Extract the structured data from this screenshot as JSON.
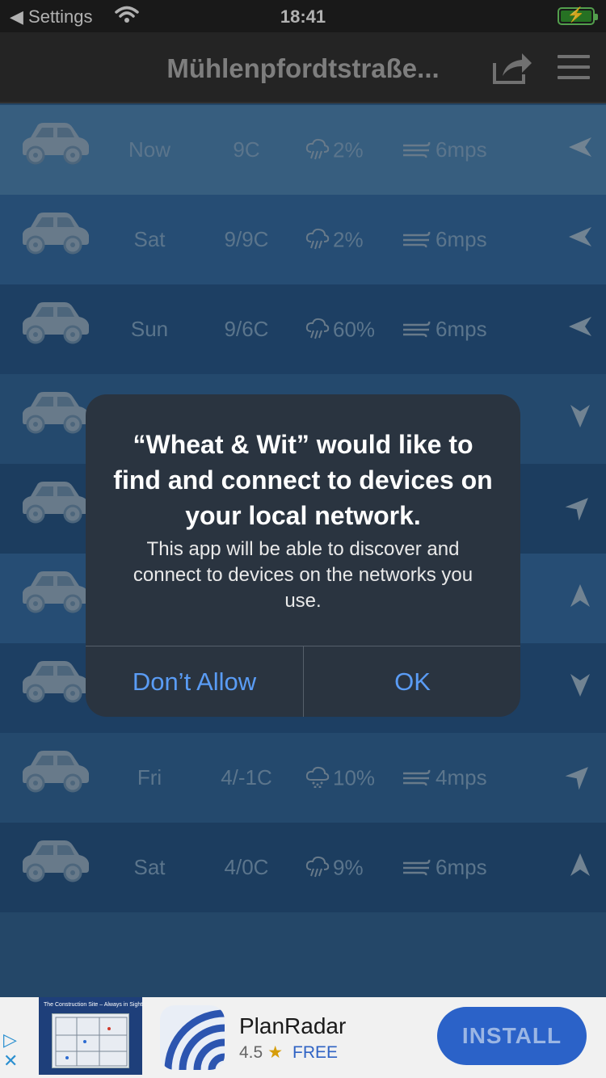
{
  "status_bar": {
    "back_label": "◀ Settings",
    "time": "18:41"
  },
  "nav": {
    "title": "Mühlenpfordtstraße..."
  },
  "rows": [
    {
      "day": "Now",
      "temp": "9C",
      "rain": "2%",
      "wind": "6mps",
      "bg": "#44739b",
      "precip_icon": "rain-cloud-icon",
      "dir_rotation_deg": 270
    },
    {
      "day": "Sat",
      "temp": "9/9C",
      "rain": "2%",
      "wind": "6mps",
      "bg": "#2f5f8e",
      "precip_icon": "rain-cloud-icon",
      "dir_rotation_deg": 270
    },
    {
      "day": "Sun",
      "temp": "9/6C",
      "rain": "60%",
      "wind": "6mps",
      "bg": "#244e79",
      "precip_icon": "rain-cloud-icon",
      "dir_rotation_deg": 270
    },
    {
      "day": "",
      "temp": "",
      "rain": "",
      "wind": "",
      "bg": "#2c5a86",
      "precip_icon": "",
      "dir_rotation_deg": 180
    },
    {
      "day": "",
      "temp": "",
      "rain": "",
      "wind": "",
      "bg": "#234b74",
      "precip_icon": "",
      "dir_rotation_deg": 45
    },
    {
      "day": "",
      "temp": "",
      "rain": "",
      "wind": "",
      "bg": "#2f5f8e",
      "precip_icon": "",
      "dir_rotation_deg": 0
    },
    {
      "day": "",
      "temp": "",
      "rain": "",
      "wind": "",
      "bg": "#244e79",
      "precip_icon": "",
      "dir_rotation_deg": 180
    },
    {
      "day": "Fri",
      "temp": "4/-1C",
      "rain": "10%",
      "wind": "4mps",
      "bg": "#2c5a86",
      "precip_icon": "snow-cloud-icon",
      "dir_rotation_deg": 45
    },
    {
      "day": "Sat",
      "temp": "4/0C",
      "rain": "9%",
      "wind": "6mps",
      "bg": "#234b74",
      "precip_icon": "rain-cloud-icon",
      "dir_rotation_deg": 0
    }
  ],
  "alert": {
    "title": "“Wheat & Wit” would like to find and connect to devices on your local network.",
    "message": "This app will be able to discover and connect to devices on the networks you use.",
    "deny_label": "Don’t Allow",
    "ok_label": "OK"
  },
  "ad": {
    "thumb_caption": "The Construction Site – Always in Sight",
    "app_name": "PlanRadar",
    "rating": "4.5",
    "price": "FREE",
    "install_label": "INSTALL"
  },
  "colors": {
    "row_text": "#6f8fab",
    "accent_blue": "#5a9cf5",
    "install_bg": "#2b62c8"
  }
}
